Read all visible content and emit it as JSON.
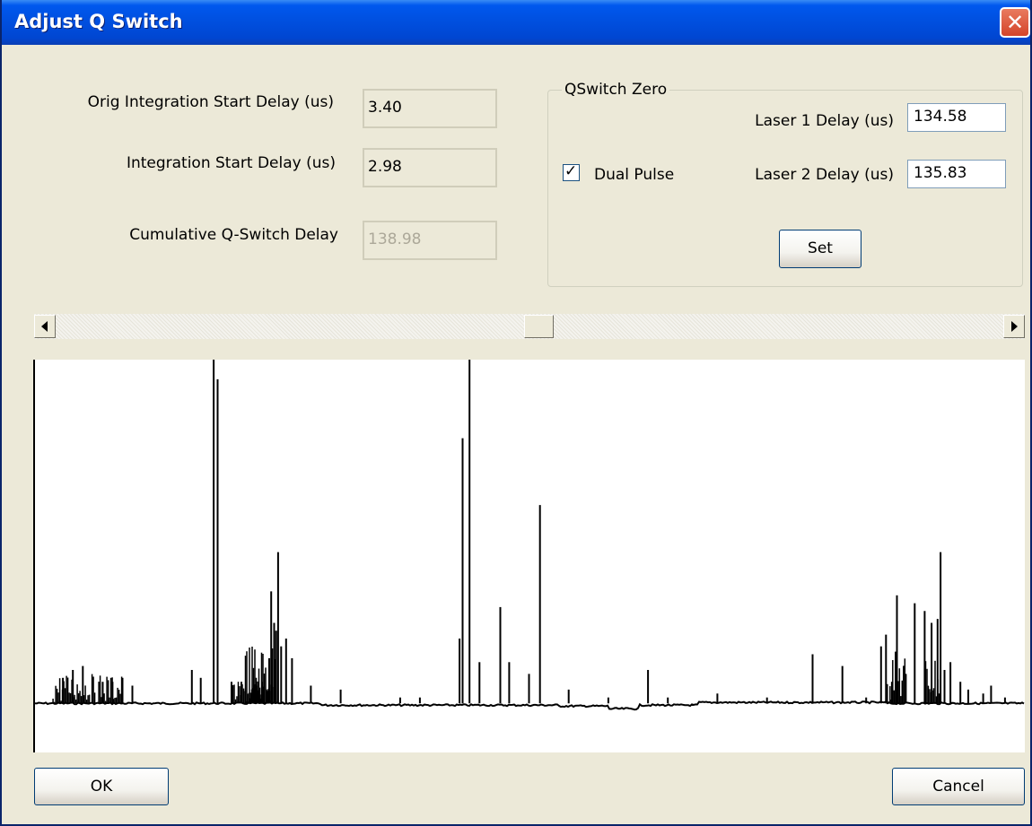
{
  "window": {
    "title": "Adjust Q Switch",
    "close_glyph": "✕",
    "close_icon": "close-icon"
  },
  "left_fields": {
    "orig_label": "Orig Integration Start Delay (us)",
    "orig_value": "3.40",
    "integ_label": "Integration Start Delay (us)",
    "integ_value": "2.98",
    "cumul_label": "Cumulative Q-Switch Delay",
    "cumul_value": "138.98"
  },
  "qswitch": {
    "group_title": "QSwitch Zero",
    "laser1_label": "Laser 1 Delay (us)",
    "laser1_value": "134.58",
    "laser2_label": "Laser 2 Delay (us)",
    "laser2_value": "135.83",
    "dual_pulse_label": "Dual Pulse",
    "dual_pulse_checked": true,
    "check_glyph": "✓",
    "set_label": "Set"
  },
  "scrollbar": {
    "position_fraction": 0.51
  },
  "buttons": {
    "ok_label": "OK",
    "cancel_label": "Cancel"
  },
  "signal_trace": {
    "baseline_fraction": 0.875,
    "spikes": [
      [
        0.182,
        0.0
      ],
      [
        0.186,
        0.05
      ],
      [
        0.247,
        0.49
      ],
      [
        0.24,
        0.59
      ],
      [
        0.243,
        0.67
      ],
      [
        0.245,
        0.69
      ],
      [
        0.25,
        0.73
      ],
      [
        0.255,
        0.71
      ],
      [
        0.261,
        0.76
      ],
      [
        0.238,
        0.76
      ],
      [
        0.44,
        0.0
      ],
      [
        0.433,
        0.2
      ],
      [
        0.43,
        0.71
      ],
      [
        0.471,
        0.63
      ],
      [
        0.511,
        0.37
      ],
      [
        0.48,
        0.77
      ],
      [
        0.45,
        0.77
      ],
      [
        0.16,
        0.79
      ],
      [
        0.62,
        0.79
      ],
      [
        0.786,
        0.75
      ],
      [
        0.816,
        0.78
      ],
      [
        0.855,
        0.73
      ],
      [
        0.866,
        0.82
      ],
      [
        0.871,
        0.6
      ],
      [
        0.86,
        0.7
      ],
      [
        0.889,
        0.62
      ],
      [
        0.915,
        0.49
      ],
      [
        0.906,
        0.67
      ],
      [
        0.899,
        0.64
      ],
      [
        0.912,
        0.66
      ],
      [
        0.919,
        0.79
      ],
      [
        0.943,
        0.84
      ],
      [
        0.966,
        0.83
      ],
      [
        0.958,
        0.85
      ],
      [
        0.05,
        0.78
      ],
      [
        0.04,
        0.79
      ],
      [
        0.03,
        0.81
      ],
      [
        0.08,
        0.82
      ],
      [
        0.09,
        0.81
      ],
      [
        0.1,
        0.83
      ],
      [
        0.07,
        0.82
      ],
      [
        0.169,
        0.81
      ],
      [
        0.2,
        0.82
      ],
      [
        0.21,
        0.82
      ],
      [
        0.28,
        0.83
      ],
      [
        0.31,
        0.84
      ],
      [
        0.37,
        0.86
      ],
      [
        0.39,
        0.86
      ],
      [
        0.5,
        0.8
      ],
      [
        0.54,
        0.84
      ],
      [
        0.58,
        0.86
      ],
      [
        0.64,
        0.86
      ],
      [
        0.69,
        0.85
      ],
      [
        0.74,
        0.86
      ],
      [
        0.84,
        0.86
      ],
      [
        0.88,
        0.8
      ],
      [
        0.925,
        0.77
      ],
      [
        0.935,
        0.82
      ],
      [
        0.98,
        0.86
      ]
    ]
  }
}
